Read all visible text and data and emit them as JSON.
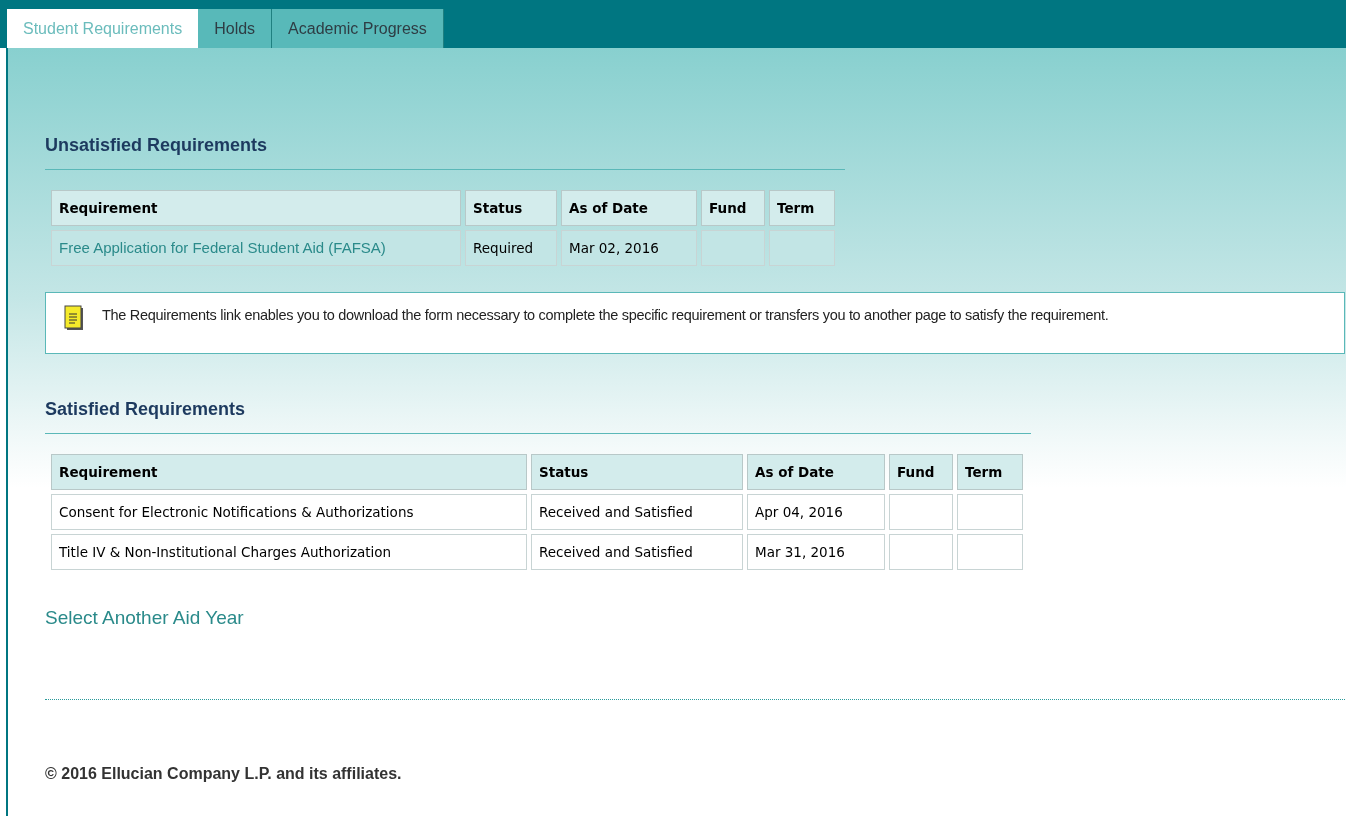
{
  "tabs": [
    {
      "label": "Student Requirements",
      "selected": true
    },
    {
      "label": "Holds",
      "selected": false
    },
    {
      "label": "Academic Progress",
      "selected": false
    }
  ],
  "unsatisfied": {
    "title": "Unsatisfied Requirements",
    "columns": [
      "Requirement",
      "Status",
      "As of Date",
      "Fund",
      "Term"
    ],
    "rows": [
      {
        "requirement": "Free Application for Federal Student Aid (FAFSA)",
        "kind": "link",
        "status": "Required",
        "as_of_date": "Mar 02, 2016"
      }
    ]
  },
  "info_note": "The Requirements link enables you to download the form necessary to complete the specific requirement or transfers you to another page to satisfy the requirement.",
  "satisfied": {
    "title": "Satisfied Requirements",
    "columns": [
      "Requirement",
      "Status",
      "As of Date",
      "Fund",
      "Term"
    ],
    "rows": [
      {
        "requirement": "Consent for Electronic Notifications & Authorizations",
        "kind": "text",
        "status": "Received and Satisfied",
        "as_of_date": "Apr 04, 2016"
      },
      {
        "requirement": "Title IV & Non-Institutional Charges Authorization",
        "kind": "text",
        "status": "Received and Satisfied",
        "as_of_date": "Mar 31, 2016"
      }
    ]
  },
  "select_link": "Select Another Aid Year",
  "footer": "© 2016 Ellucian Company L.P. and its affiliates."
}
